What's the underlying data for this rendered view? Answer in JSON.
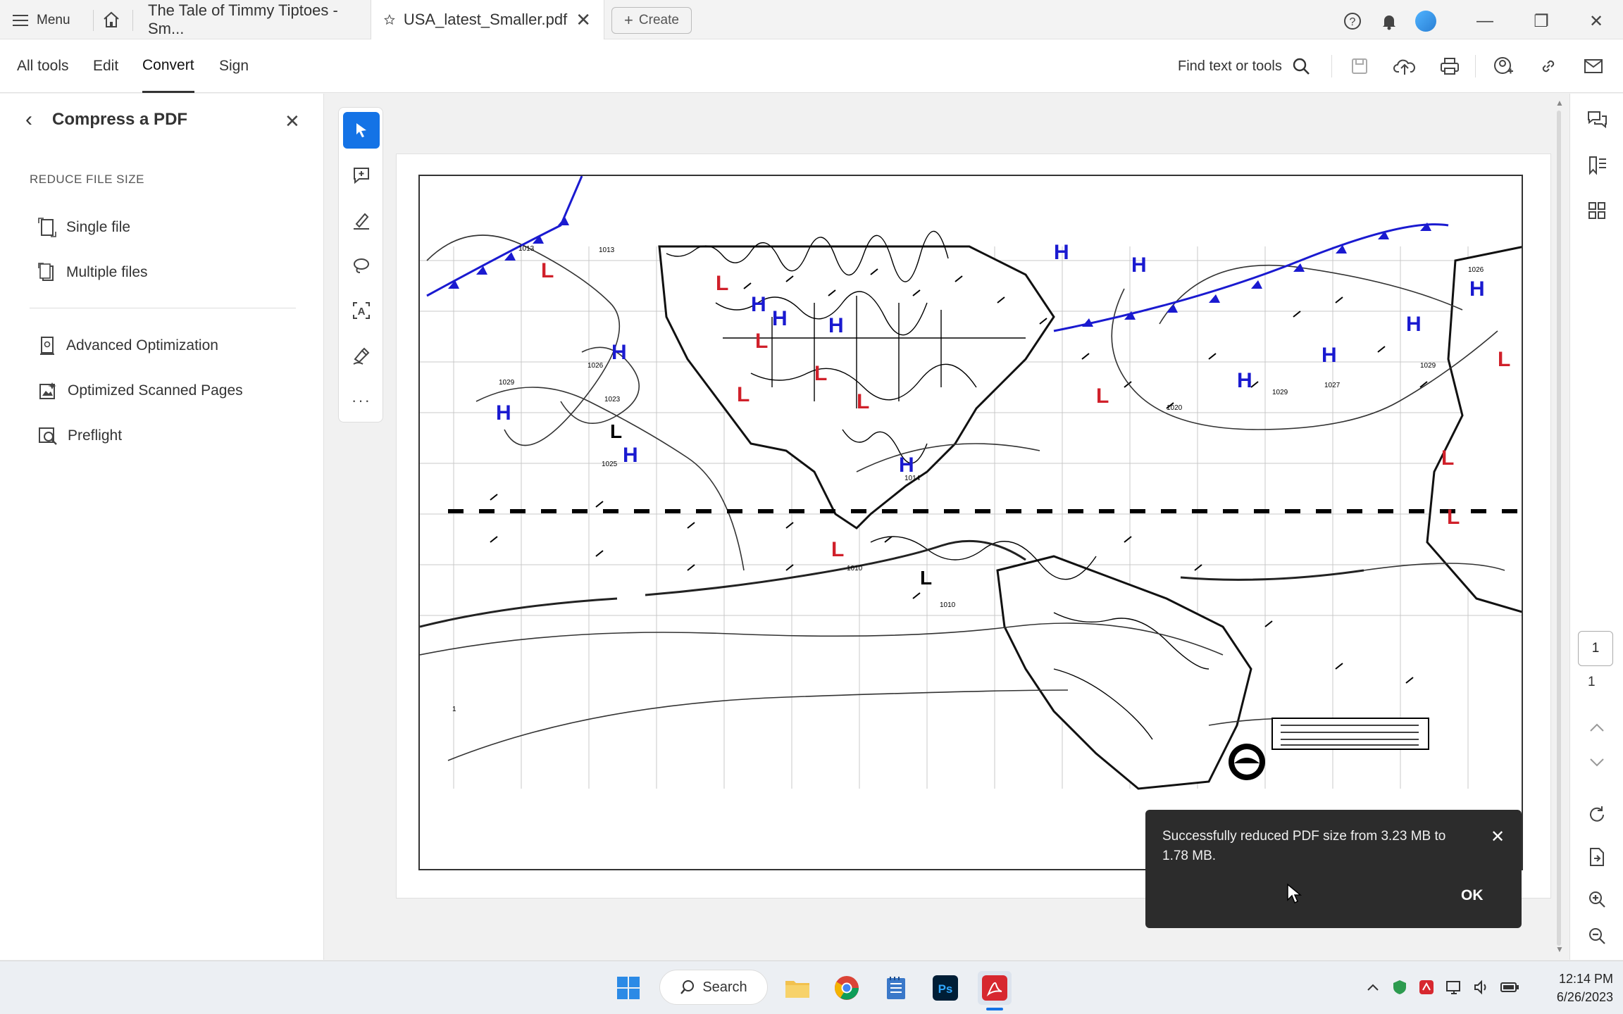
{
  "titlebar": {
    "menu_label": "Menu",
    "tabs": [
      {
        "title": "The Tale of Timmy Tiptoes - Sm..."
      },
      {
        "title": "USA_latest_Smaller.pdf"
      }
    ],
    "create_label": "Create"
  },
  "toolbar": {
    "menu": [
      "All tools",
      "Edit",
      "Convert",
      "Sign"
    ],
    "find_label": "Find text or tools"
  },
  "panel": {
    "title": "Compress a PDF",
    "section_label": "REDUCE FILE SIZE",
    "items": [
      "Single file",
      "Multiple files",
      "Advanced Optimization",
      "Optimized Scanned Pages",
      "Preflight"
    ]
  },
  "pagination": {
    "current": "1",
    "total": "1"
  },
  "toast": {
    "message": "Successfully reduced PDF size from 3.23 MB to 1.78 MB.",
    "ok_label": "OK"
  },
  "taskbar": {
    "search_label": "Search",
    "time": "12:14 PM",
    "date": "6/26/2023"
  },
  "colors": {
    "accent": "#1473e6",
    "toast_bg": "#2c2c2c",
    "high": "#1a1ad0",
    "low": "#d0202a"
  }
}
